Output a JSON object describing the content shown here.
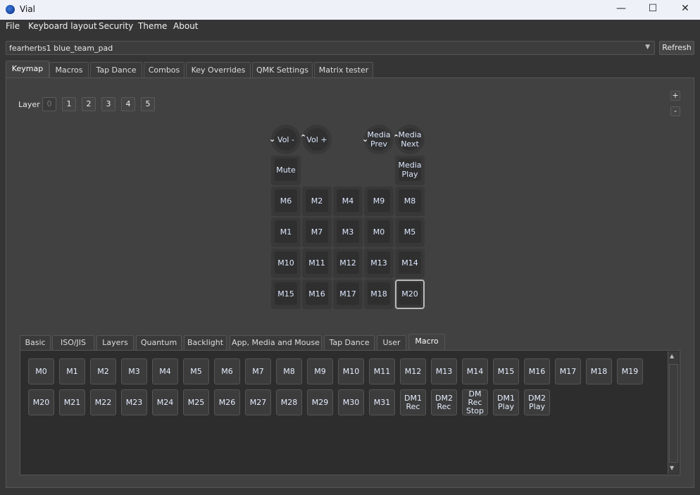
{
  "window": {
    "title": "Vial",
    "controls": [
      "—",
      "☐",
      "✕"
    ]
  },
  "menu": [
    "File",
    "Keyboard layout",
    "Security",
    "Theme",
    "About"
  ],
  "device": {
    "selected": "fearherbs1 blue_team_pad",
    "refresh_label": "Refresh"
  },
  "tabs": [
    "Keymap",
    "Macros",
    "Tap Dance",
    "Combos",
    "Key Overrides",
    "QMK Settings",
    "Matrix tester"
  ],
  "active_tab": "Keymap",
  "layer": {
    "label": "Layer",
    "buttons": [
      "0",
      "1",
      "2",
      "3",
      "4",
      "5"
    ],
    "active": "0"
  },
  "zoom": {
    "plus": "+",
    "minus": "-"
  },
  "encoders": [
    {
      "ccw": "Vol -",
      "cw": "Vol +"
    },
    {
      "ccw": "Media\nPrev",
      "cw": "Media\nNext"
    }
  ],
  "keymap": {
    "row0": [
      "Mute",
      "",
      "",
      "",
      "Media\nPlay"
    ],
    "grid": [
      [
        "M6",
        "M2",
        "M4",
        "M9",
        "M8"
      ],
      [
        "M1",
        "M7",
        "M3",
        "M0",
        "M5"
      ],
      [
        "M10",
        "M11",
        "M12",
        "M13",
        "M14"
      ],
      [
        "M15",
        "M16",
        "M17",
        "M18",
        "M20"
      ]
    ],
    "selected": "M20"
  },
  "picker_tabs": [
    "Basic",
    "ISO/JIS",
    "Layers",
    "Quantum",
    "Backlight",
    "App, Media and Mouse",
    "Tap Dance",
    "User",
    "Macro"
  ],
  "picker_active": "Macro",
  "macro_keys": [
    [
      "M0",
      "M1",
      "M2",
      "M3",
      "M4",
      "M5",
      "M6",
      "M7",
      "M8",
      "M9",
      "M10",
      "M11",
      "M12",
      "M13",
      "M14",
      "M15",
      "M16",
      "M17",
      "M18",
      "M19"
    ],
    [
      "M20",
      "M21",
      "M22",
      "M23",
      "M24",
      "M25",
      "M26",
      "M27",
      "M28",
      "M29",
      "M30",
      "M31",
      "DM1\nRec",
      "DM2\nRec",
      "DM Rec\nStop",
      "DM1\nPlay",
      "DM2\nPlay"
    ]
  ]
}
